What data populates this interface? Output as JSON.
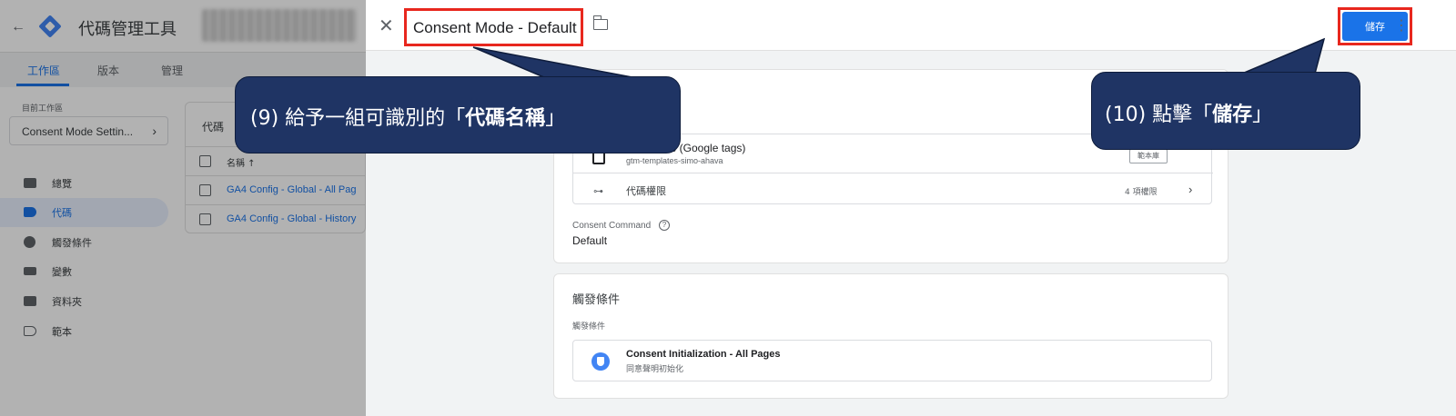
{
  "app": {
    "title": "代碼管理工具",
    "back_icon": "arrow-back-icon"
  },
  "top_tabs": [
    {
      "label": "工作區",
      "active": true
    },
    {
      "label": "版本",
      "active": false
    },
    {
      "label": "管理",
      "active": false
    }
  ],
  "workspace": {
    "label": "目前工作區",
    "selected": "Consent Mode Settin..."
  },
  "sidebar": {
    "items": [
      {
        "label": "總覽",
        "icon": "briefcase-icon",
        "active": false
      },
      {
        "label": "代碼",
        "icon": "tag-icon",
        "active": true
      },
      {
        "label": "觸發條件",
        "icon": "trigger-icon",
        "active": false
      },
      {
        "label": "變數",
        "icon": "variables-icon",
        "active": false
      },
      {
        "label": "資料夾",
        "icon": "folder-icon",
        "active": false
      },
      {
        "label": "範本",
        "icon": "template-icon",
        "active": false
      }
    ]
  },
  "tags_list": {
    "header": "代碼",
    "column": "名稱 ↑",
    "rows": [
      "GA4 Config - Global - All Pag",
      "GA4 Config - Global - History"
    ]
  },
  "panel": {
    "tag_name": "Consent Mode - Default",
    "save_label": "儲存",
    "template": {
      "name": "de (Google tags)",
      "author": "gtm-templates-simo-ahava",
      "badge": "範本庫"
    },
    "permissions": {
      "label": "代碼權限",
      "count": "4 項權限"
    },
    "consent_command": {
      "label": "Consent Command",
      "value": "Default"
    },
    "triggering": {
      "title": "觸發條件",
      "subtitle": "觸發條件",
      "trigger_name": "Consent Initialization - All Pages",
      "trigger_desc": "同意聲明初始化"
    }
  },
  "annotations": {
    "step9_prefix": "(9) 給予一組可識別的「",
    "step9_bold": "代碼名稱",
    "step9_suffix": "」",
    "step10_prefix": "(10) 點擊「",
    "step10_bold": "儲存",
    "step10_suffix": "」"
  },
  "colors": {
    "accent": "#1a73e8",
    "highlight": "#e8271e",
    "callout_bg": "#1f3464"
  }
}
